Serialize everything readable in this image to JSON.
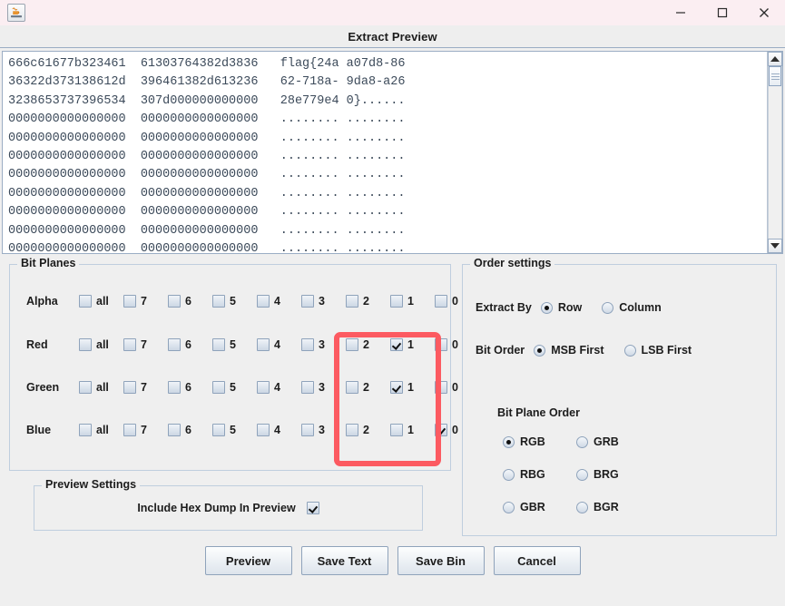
{
  "window": {
    "app_icon": "java-coffee-cup-icon",
    "controls": {
      "minimize": "minimize-icon",
      "maximize": "maximize-icon",
      "close": "close-icon"
    }
  },
  "dialog": {
    "title": "Extract Preview"
  },
  "preview": {
    "lines": [
      "666c61677b323461  61303764382d3836   flag{24a a07d8-86",
      "36322d373138612d  396461382d613236   62-718a- 9da8-a26",
      "3238653737396534  307d000000000000   28e779e4 0}......",
      "0000000000000000  0000000000000000   ........ ........",
      "0000000000000000  0000000000000000   ........ ........",
      "0000000000000000  0000000000000000   ........ ........",
      "0000000000000000  0000000000000000   ........ ........",
      "0000000000000000  0000000000000000   ........ ........",
      "0000000000000000  0000000000000000   ........ ........",
      "0000000000000000  0000000000000000   ........ ........",
      "0000000000000000  0000000000000000   ........ ........"
    ],
    "scrollbar": {
      "up_arrow": "scroll-up-icon",
      "down_arrow": "scroll-down-icon"
    }
  },
  "bit_planes": {
    "legend": "Bit Planes",
    "columns": [
      "all",
      "7",
      "6",
      "5",
      "4",
      "3",
      "2",
      "1",
      "0"
    ],
    "rows": [
      {
        "label": "Alpha",
        "checked": [
          false,
          false,
          false,
          false,
          false,
          false,
          false,
          false,
          false
        ]
      },
      {
        "label": "Red",
        "checked": [
          false,
          false,
          false,
          false,
          false,
          false,
          false,
          true,
          false
        ]
      },
      {
        "label": "Green",
        "checked": [
          false,
          false,
          false,
          false,
          false,
          false,
          false,
          true,
          false
        ]
      },
      {
        "label": "Blue",
        "checked": [
          false,
          false,
          false,
          false,
          false,
          false,
          false,
          false,
          true
        ]
      }
    ],
    "highlight_color": "#fc5a61"
  },
  "order_settings": {
    "legend": "Order settings",
    "extract_by": {
      "caption": "Extract By",
      "options": [
        "Row",
        "Column"
      ],
      "selected": "Row"
    },
    "bit_order": {
      "caption": "Bit Order",
      "options": [
        "MSB First",
        "LSB First"
      ],
      "selected": "MSB First"
    },
    "bit_plane_order": {
      "caption": "Bit Plane Order",
      "options": [
        "RGB",
        "GRB",
        "RBG",
        "BRG",
        "GBR",
        "BGR"
      ],
      "selected": "RGB"
    }
  },
  "preview_settings": {
    "legend": "Preview Settings",
    "include_hex_dump_label": "Include Hex Dump In Preview",
    "include_hex_dump_checked": true
  },
  "buttons": [
    {
      "label": "Preview"
    },
    {
      "label": "Save Text"
    },
    {
      "label": "Save Bin"
    },
    {
      "label": "Cancel"
    }
  ]
}
